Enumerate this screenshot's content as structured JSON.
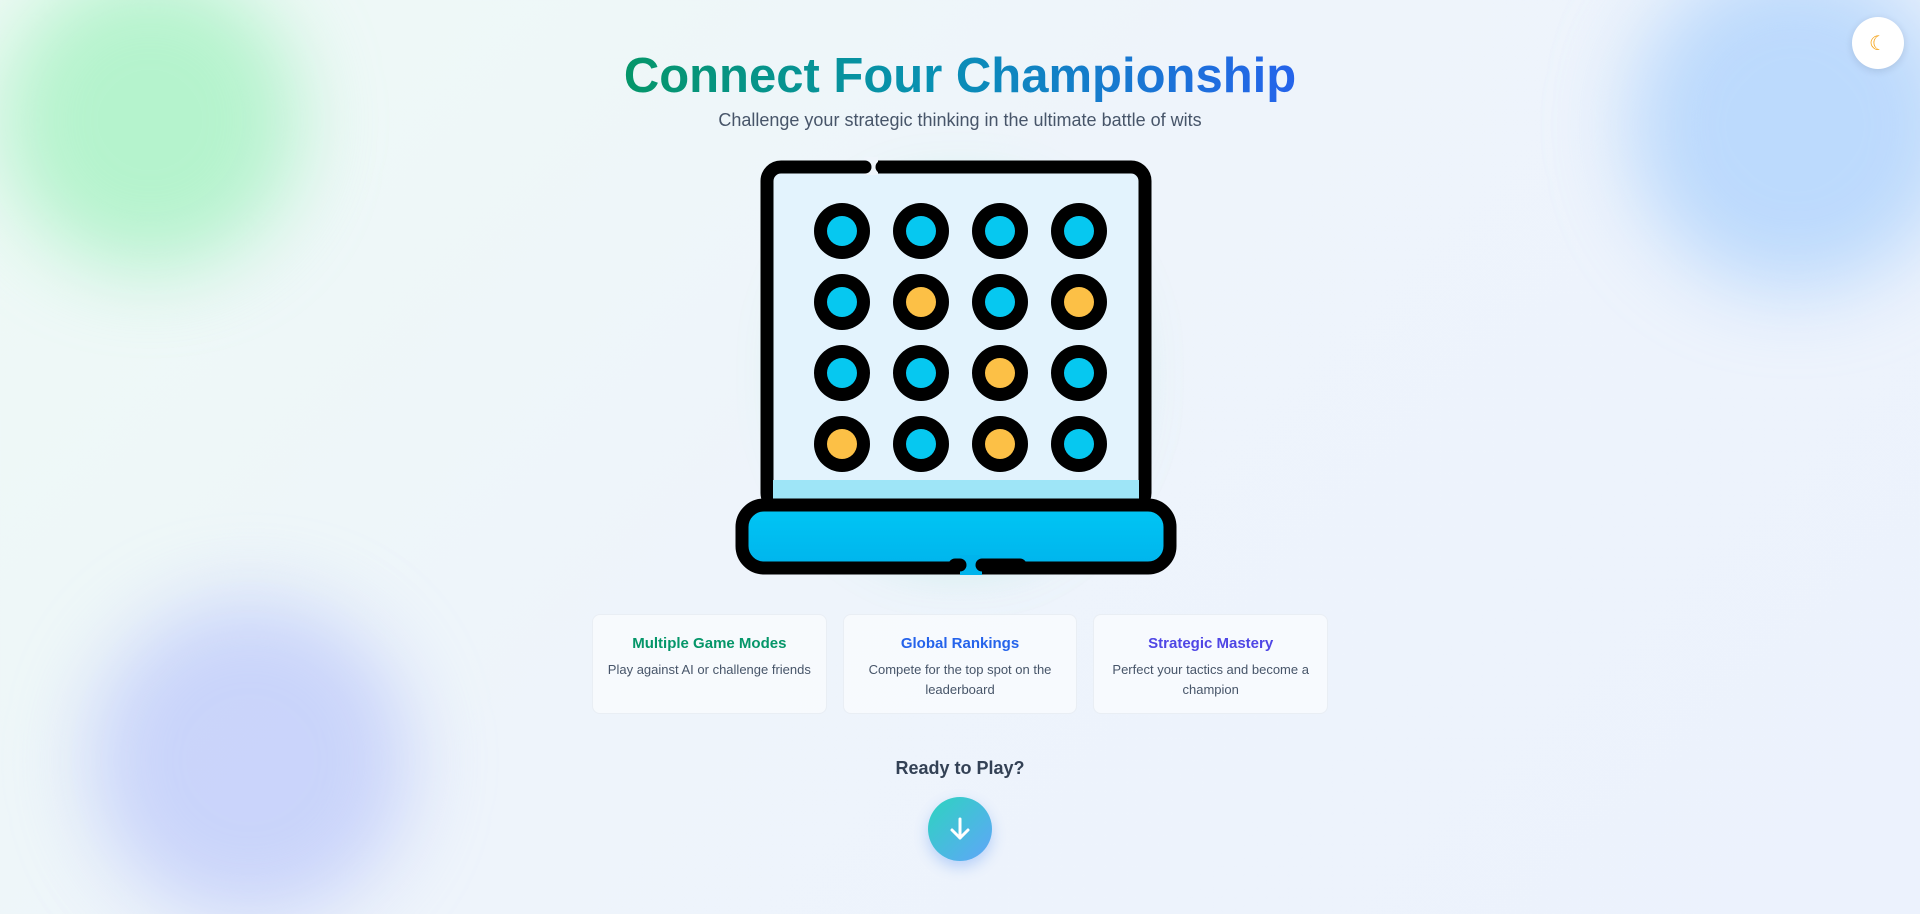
{
  "header": {
    "title": "Connect Four Championship",
    "subtitle": "Challenge your strategic thinking in the ultimate battle of wits"
  },
  "theme_toggle": {
    "icon": "moon-icon"
  },
  "board": {
    "rows": 4,
    "cols": 4,
    "colors": {
      "cyan": "#06c8f0",
      "yellow": "#fcc046",
      "frame": "#000000",
      "panel": "#e3f3fd",
      "stand": "#06c8f0"
    },
    "pieces": [
      [
        "cyan",
        "cyan",
        "cyan",
        "cyan"
      ],
      [
        "cyan",
        "yellow",
        "cyan",
        "yellow"
      ],
      [
        "cyan",
        "cyan",
        "yellow",
        "cyan"
      ],
      [
        "yellow",
        "cyan",
        "yellow",
        "cyan"
      ]
    ]
  },
  "features": [
    {
      "title": "Multiple Game Modes",
      "description": "Play against AI or challenge friends",
      "color": "#059669"
    },
    {
      "title": "Global Rankings",
      "description": "Compete for the top spot on the leaderboard",
      "color": "#2563eb"
    },
    {
      "title": "Strategic Mastery",
      "description": "Perfect your tactics and become a champion",
      "color": "#4f46e5"
    }
  ],
  "cta": {
    "label": "Ready to Play?",
    "icon": "arrow-down-icon"
  }
}
